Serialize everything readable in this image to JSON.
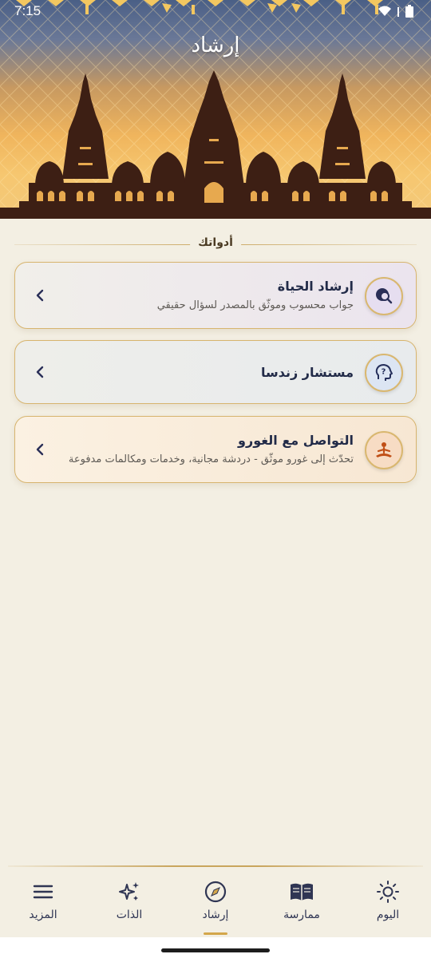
{
  "status_bar": {
    "time": "7:15",
    "icons": [
      "wifi-icon",
      "signal-icon",
      "battery-icon"
    ]
  },
  "header": {
    "title": "إرشاد"
  },
  "section": {
    "label": "أدواتك"
  },
  "cards": [
    {
      "title": "إرشاد الحياة",
      "subtitle": "جواب محسوب وموثّق بالمصدر لسؤال حقيقي",
      "icon": "search-globe-icon",
      "bg": "#ece7ee"
    },
    {
      "title": "مستشار زندسا",
      "subtitle": "",
      "icon": "question-head-icon",
      "bg": "#ecece8"
    },
    {
      "title": "التواصل مع الغورو",
      "subtitle": "تحدّث إلى غورو موثّق - دردشة مجانية، وخدمات ومكالمات مدفوعة",
      "icon": "meditation-icon",
      "bg": "#f6e8d4"
    }
  ],
  "nav": {
    "items": [
      {
        "label": "اليوم",
        "icon": "sun-icon"
      },
      {
        "label": "ممارسة",
        "icon": "book-icon"
      },
      {
        "label": "إرشاد",
        "icon": "compass-icon",
        "active": true
      },
      {
        "label": "الذات",
        "icon": "sparkle-icon"
      },
      {
        "label": "المزيد",
        "icon": "menu-icon"
      }
    ]
  },
  "colors": {
    "accent": "#d3a64a",
    "navy": "#222b48",
    "background": "#f3efe3"
  }
}
